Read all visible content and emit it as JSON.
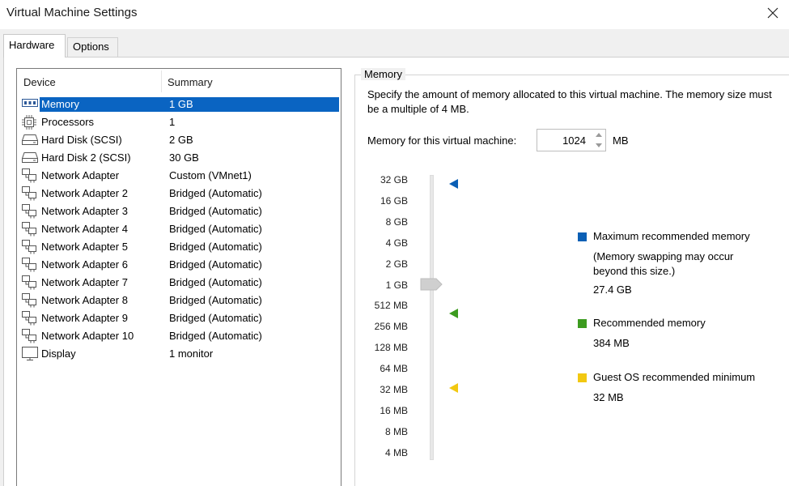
{
  "window": {
    "title": "Virtual Machine Settings"
  },
  "tabs": [
    {
      "label": "Hardware",
      "active": true
    },
    {
      "label": "Options",
      "active": false
    }
  ],
  "device_list": {
    "columns": [
      "Device",
      "Summary"
    ],
    "rows": [
      {
        "device": "Memory",
        "summary": "1 GB",
        "icon": "memory-icon",
        "selected": true
      },
      {
        "device": "Processors",
        "summary": "1",
        "icon": "processor-icon"
      },
      {
        "device": "Hard Disk (SCSI)",
        "summary": "2 GB",
        "icon": "hard-disk-icon"
      },
      {
        "device": "Hard Disk 2 (SCSI)",
        "summary": "30 GB",
        "icon": "hard-disk-icon"
      },
      {
        "device": "Network Adapter",
        "summary": "Custom (VMnet1)",
        "icon": "network-adapter-icon"
      },
      {
        "device": "Network Adapter 2",
        "summary": "Bridged (Automatic)",
        "icon": "network-adapter-icon"
      },
      {
        "device": "Network Adapter 3",
        "summary": "Bridged (Automatic)",
        "icon": "network-adapter-icon"
      },
      {
        "device": "Network Adapter 4",
        "summary": "Bridged (Automatic)",
        "icon": "network-adapter-icon"
      },
      {
        "device": "Network Adapter 5",
        "summary": "Bridged (Automatic)",
        "icon": "network-adapter-icon"
      },
      {
        "device": "Network Adapter 6",
        "summary": "Bridged (Automatic)",
        "icon": "network-adapter-icon"
      },
      {
        "device": "Network Adapter 7",
        "summary": "Bridged (Automatic)",
        "icon": "network-adapter-icon"
      },
      {
        "device": "Network Adapter 8",
        "summary": "Bridged (Automatic)",
        "icon": "network-adapter-icon"
      },
      {
        "device": "Network Adapter 9",
        "summary": "Bridged (Automatic)",
        "icon": "network-adapter-icon"
      },
      {
        "device": "Network Adapter 10",
        "summary": "Bridged (Automatic)",
        "icon": "network-adapter-icon"
      },
      {
        "device": "Display",
        "summary": "1 monitor",
        "icon": "display-icon"
      }
    ]
  },
  "memory": {
    "group_title": "Memory",
    "description": "Specify the amount of memory allocated to this virtual machine. The memory size must be a multiple of 4 MB.",
    "field_label": "Memory for this virtual machine:",
    "value": "1024",
    "unit": "MB",
    "scale_ticks": [
      "32 GB",
      "16 GB",
      "8 GB",
      "4 GB",
      "2 GB",
      "1 GB",
      "512 MB",
      "256 MB",
      "128 MB",
      "64 MB",
      "32 MB",
      "16 MB",
      "8 MB",
      "4 MB"
    ],
    "slider_value": "1 GB",
    "legend": [
      {
        "title": "Maximum recommended memory",
        "note": "(Memory swapping may occur beyond this size.)",
        "value": "27.4 GB",
        "color": "#0b5fb5"
      },
      {
        "title": "Recommended memory",
        "value": "384 MB",
        "color": "#3c9b1f"
      },
      {
        "title": "Guest OS recommended minimum",
        "value": "32 MB",
        "color": "#f2c811"
      }
    ]
  },
  "colors": {
    "selection": "#0a64c2",
    "accent_blue": "#0b5fb5",
    "accent_green": "#3c9b1f",
    "accent_yellow": "#f2c811"
  }
}
